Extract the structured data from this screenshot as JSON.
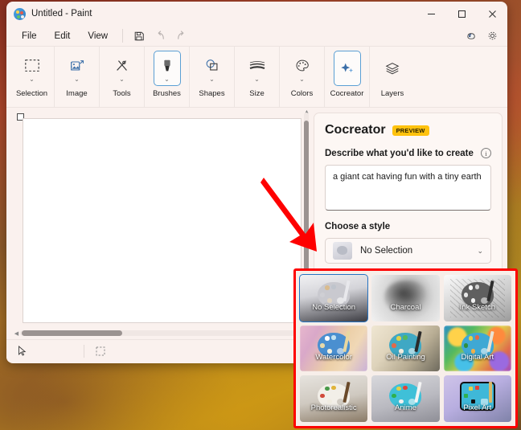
{
  "window": {
    "title": "Untitled - Paint",
    "app_icon": "paint-palette-icon",
    "controls": {
      "minimize": "—",
      "maximize": "□",
      "close": "✕"
    }
  },
  "menubar": {
    "items": [
      "File",
      "Edit",
      "View"
    ],
    "quick_actions": [
      "save-icon",
      "undo-icon",
      "redo-icon"
    ],
    "right_icons": [
      "copilot-icon",
      "settings-gear-icon"
    ]
  },
  "ribbon": {
    "groups": [
      {
        "label": "Selection",
        "icon": "selection-rectangle-icon",
        "active": false,
        "chevron": true
      },
      {
        "label": "Image",
        "icon": "image-crop-icon",
        "active": false,
        "chevron": true
      },
      {
        "label": "Tools",
        "icon": "pencil-tools-icon",
        "active": false,
        "chevron": true
      },
      {
        "label": "Brushes",
        "icon": "brush-icon",
        "active": true,
        "chevron": true
      },
      {
        "label": "Shapes",
        "icon": "shapes-icon",
        "active": false,
        "chevron": true
      },
      {
        "label": "Size",
        "icon": "line-size-icon",
        "active": false,
        "chevron": true
      },
      {
        "label": "Colors",
        "icon": "color-palette-icon",
        "active": false,
        "chevron": true
      },
      {
        "label": "Cocreator",
        "icon": "sparkle-icon",
        "active": true,
        "chevron": false
      },
      {
        "label": "Layers",
        "icon": "layers-icon",
        "active": false,
        "chevron": false
      }
    ]
  },
  "canvas": {
    "resize_handle": "canvas-resize-handle",
    "status": {
      "cursor_icon": "cursor-arrow-icon",
      "selection_icon": "selection-size-icon"
    },
    "h_scrollbar": "horizontal-scrollbar",
    "v_scrollbar": "vertical-scrollbar"
  },
  "cocreator": {
    "title": "Cocreator",
    "badge": "PREVIEW",
    "describe_label": "Describe what you'd like to create",
    "info_icon": "i",
    "prompt_value": "a giant cat having fun with a tiny earth",
    "prompt_placeholder": "Describe what you'd like to create",
    "style_label": "Choose a style",
    "selected_style": "No Selection",
    "dropdown_chevron": "⌄"
  },
  "style_grid": {
    "callout_color": "#fe0000",
    "selected_index": 0,
    "tiles": [
      {
        "label": "No Selection",
        "bg": "bg-none",
        "selected": true,
        "palette": "#c9c9cf",
        "dots": [
          "#d9bb8e",
          "#cfcfd4",
          "#bfc4cc",
          "#e0d5c4"
        ],
        "brush": "#e8e8ec"
      },
      {
        "label": "Charcoal",
        "bg": "bg-char",
        "selected": false,
        "palette": "#6e6e6e",
        "dots": [
          "#9a9a9a",
          "#7d7d7d",
          "#8c8c8c",
          "#bdbdbd"
        ],
        "brush": "#4a4a4a"
      },
      {
        "label": "Ink Sketch",
        "bg": "bg-ink",
        "selected": false,
        "palette": "#5f5f5f",
        "dots": [
          "#ffffff",
          "#e6e6e6",
          "#d2d2d2",
          "#f2f2f2"
        ],
        "brush": "#2e2e2e"
      },
      {
        "label": "Watercolor",
        "bg": "bg-water",
        "selected": false,
        "palette": "#4a8fd0",
        "dots": [
          "#ffffff",
          "#e8d9a8",
          "#c3e2f0",
          "#f2f0e0"
        ],
        "brush": "#e8d7a0"
      },
      {
        "label": "Oil Painting",
        "bg": "bg-oil",
        "selected": false,
        "palette": "#3fa8c4",
        "dots": [
          "#e0d24a",
          "#e06a4a",
          "#53b95f",
          "#f0ece0"
        ],
        "brush": "#2a2a2a"
      },
      {
        "label": "Digital Art",
        "bg": "bg-digi",
        "selected": false,
        "palette": "#3fa8d4",
        "dots": [
          "#e0d24a",
          "#2e8f3e",
          "#e06a4a",
          "#f0b04a"
        ],
        "brush": "#e8e2d4"
      },
      {
        "label": "Photorealistic",
        "bg": "bg-photo",
        "selected": false,
        "palette": "#f2efe8",
        "dots": [
          "#4a9a4a",
          "#d04a3a",
          "#e0b43a",
          "#f0ece0"
        ],
        "brush": "#6a4a2a"
      },
      {
        "label": "Anime",
        "bg": "bg-anime",
        "selected": false,
        "palette": "#3fc0d8",
        "dots": [
          "#e0d24a",
          "#2eb04e",
          "#e0443a",
          "#f0f0f0"
        ],
        "brush": "#f4f4f4"
      },
      {
        "label": "Pixel Art",
        "bg": "bg-pixel",
        "selected": false,
        "palette": "#3fb8d8",
        "dots": [
          "#e0d24a",
          "#2eb04e",
          "#e0443a",
          "#1a1a1a"
        ],
        "brush": "#d8b86a"
      }
    ]
  }
}
